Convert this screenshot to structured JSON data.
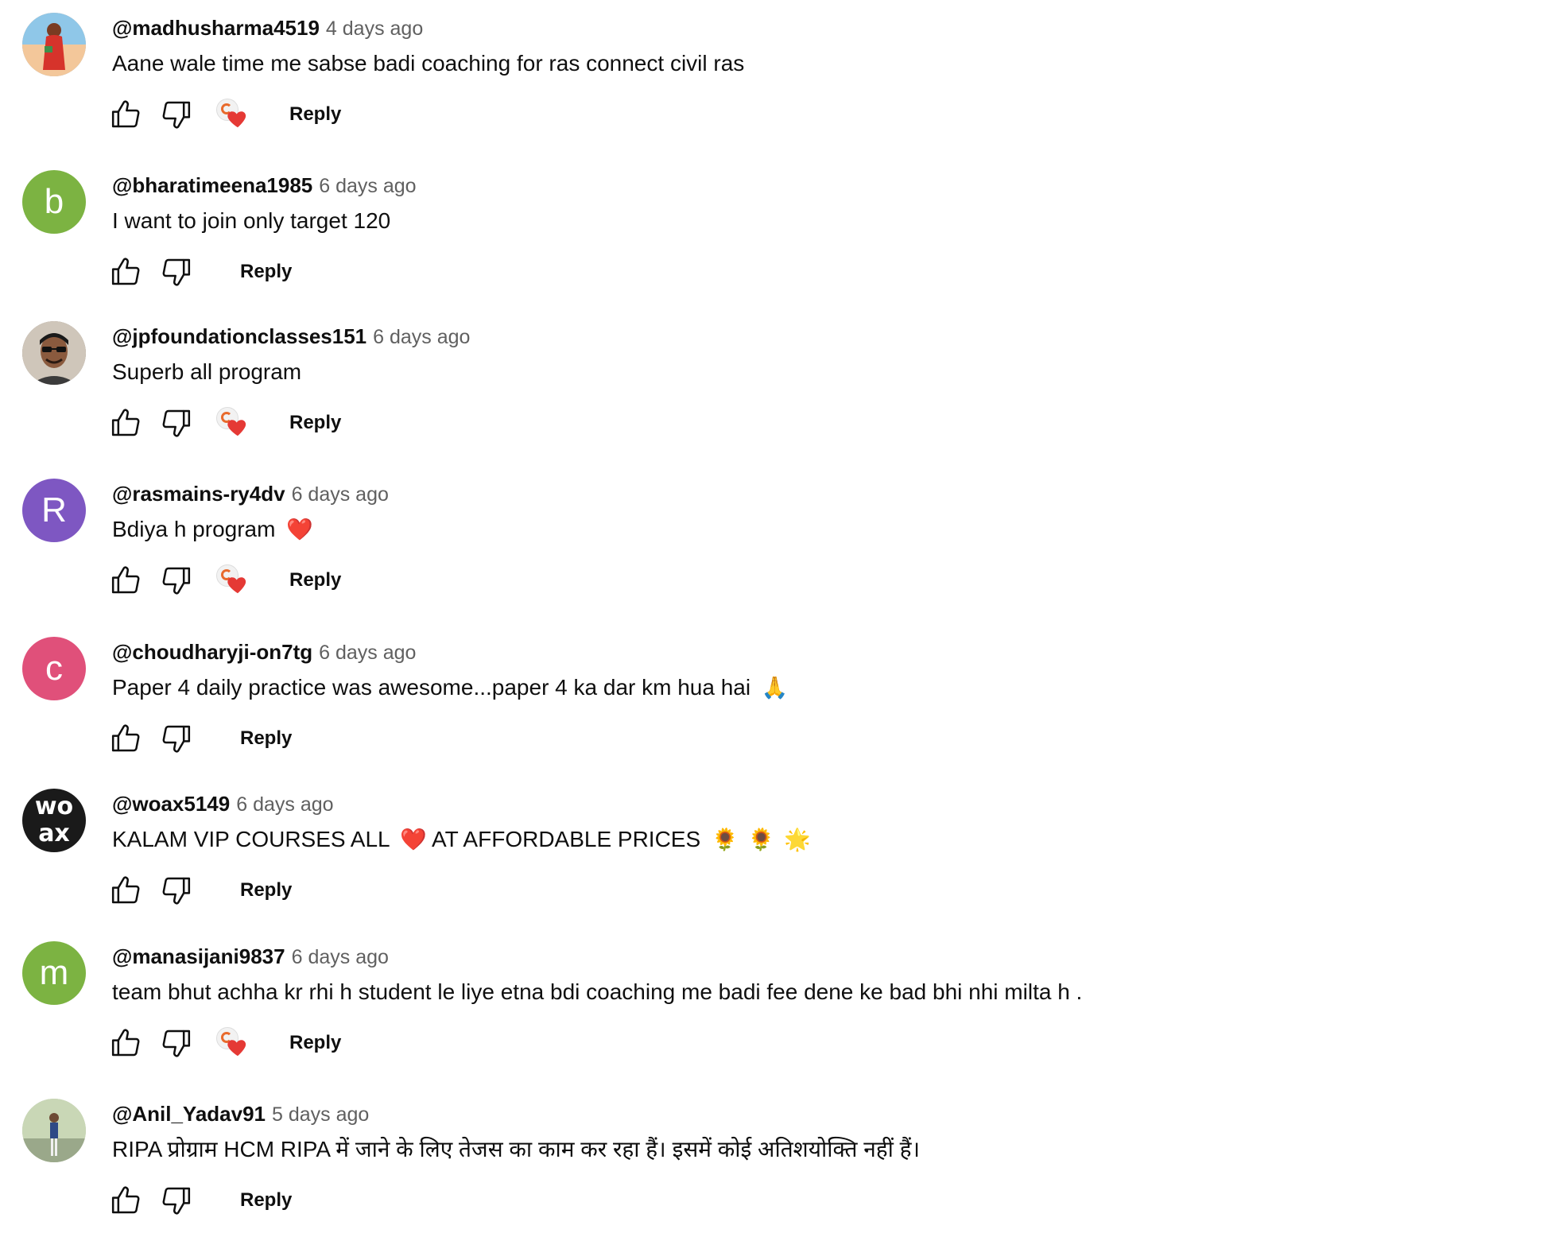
{
  "comments": [
    {
      "author": "@madhusharma4519",
      "time": "4 days ago",
      "text": "Aane wale time me sabse badi coaching for ras connect civil ras",
      "hearted": true,
      "avatar": {
        "type": "photo",
        "letter": "",
        "color": "#f4b083"
      },
      "reply_label": "Reply"
    },
    {
      "author": "@bharatimeena1985",
      "time": "6 days ago",
      "text": "I want to join only target 120",
      "hearted": false,
      "avatar": {
        "type": "letter",
        "letter": "b",
        "color": "#7cb342"
      },
      "reply_label": "Reply"
    },
    {
      "author": "@jpfoundationclasses151",
      "time": "6 days ago",
      "text": "Superb all program",
      "hearted": true,
      "avatar": {
        "type": "photo",
        "letter": "",
        "color": "#8a7b6c"
      },
      "reply_label": "Reply"
    },
    {
      "author": "@rasmains-ry4dv",
      "time": "6 days ago",
      "text": "Bdiya h program",
      "emoji_after": "❤️",
      "hearted": true,
      "avatar": {
        "type": "letter",
        "letter": "R",
        "color": "#7e57c2"
      },
      "reply_label": "Reply"
    },
    {
      "author": "@choudharyji-on7tg",
      "time": "6 days ago",
      "text": "Paper 4 daily practice was awesome...paper 4 ka dar km hua hai",
      "emoji_after": "🙏",
      "hearted": false,
      "avatar": {
        "type": "letter",
        "letter": "c",
        "color": "#e0507a"
      },
      "reply_label": "Reply"
    },
    {
      "author": "@woax5149",
      "time": "6 days ago",
      "text_parts": [
        "KALAM VIP COURSES ALL",
        "❤️",
        "AT AFFORDABLE PRICES",
        "🌻",
        "🌻",
        "🌟"
      ],
      "hearted": false,
      "avatar": {
        "type": "text-logo",
        "letter": "wo ax",
        "color": "#1a1a1a"
      },
      "reply_label": "Reply"
    },
    {
      "author": "@manasijani9837",
      "time": "6 days ago",
      "text": "team bhut achha kr rhi h student le liye etna bdi coaching me badi fee dene ke bad bhi nhi milta h .",
      "hearted": true,
      "avatar": {
        "type": "letter",
        "letter": "m",
        "color": "#7cb342"
      },
      "reply_label": "Reply"
    },
    {
      "author": "@Anil_Yadav91",
      "time": "5 days ago",
      "text": "RIPA प्रोग्राम HCM RIPA में जाने के लिए तेजस का काम कर रहा हैं। इसमें कोई अतिशयोक्ति नहीं हैं।",
      "hearted": false,
      "avatar": {
        "type": "photo",
        "letter": "",
        "color": "#b7c4a8"
      },
      "reply_label": "Reply"
    }
  ],
  "icons": {
    "like": "thumb-up-icon",
    "dislike": "thumb-down-icon",
    "heart": "creator-heart-icon"
  },
  "colors": {
    "text": "#0f0f0f",
    "secondary": "#606060",
    "heart": "#e53935"
  }
}
